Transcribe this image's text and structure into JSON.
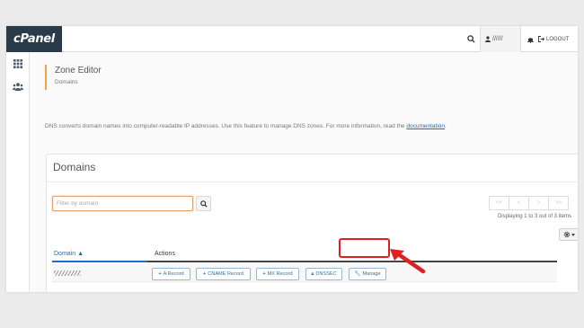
{
  "topbar": {
    "logo": "cPanel",
    "user_label": "//////",
    "logout_label": "LOGOUT"
  },
  "sidebar": {
    "items": [
      {
        "icon": "grid-icon"
      },
      {
        "icon": "users-icon"
      }
    ]
  },
  "page": {
    "title": "Zone Editor",
    "breadcrumb": "Domains",
    "description": "DNS converts domain names into computer-readable IP addresses. Use this feature to manage DNS zones. For more information, read the",
    "doc_link": "documentation",
    "doc_suffix": "."
  },
  "panel": {
    "title": "Domains",
    "filter_placeholder": "Filter by domain",
    "filter_value": "",
    "pager": [
      "<<",
      "<",
      ">",
      ">>"
    ],
    "displaying": "Displaying 1 to 3 out of 3 items",
    "columns": {
      "domain": "Domain ▲",
      "actions": "Actions"
    },
    "action_labels": {
      "a_record": "A Record",
      "cname_record": "CNAME Record",
      "mx_record": "MX Record",
      "dnssec": "DNSSEC",
      "manage": "Manage"
    }
  },
  "colors": {
    "accent": "#1b6ec2",
    "highlight": "#e02020",
    "logo_bg": "#293a4a",
    "heading_bar": "#f4a23a"
  }
}
